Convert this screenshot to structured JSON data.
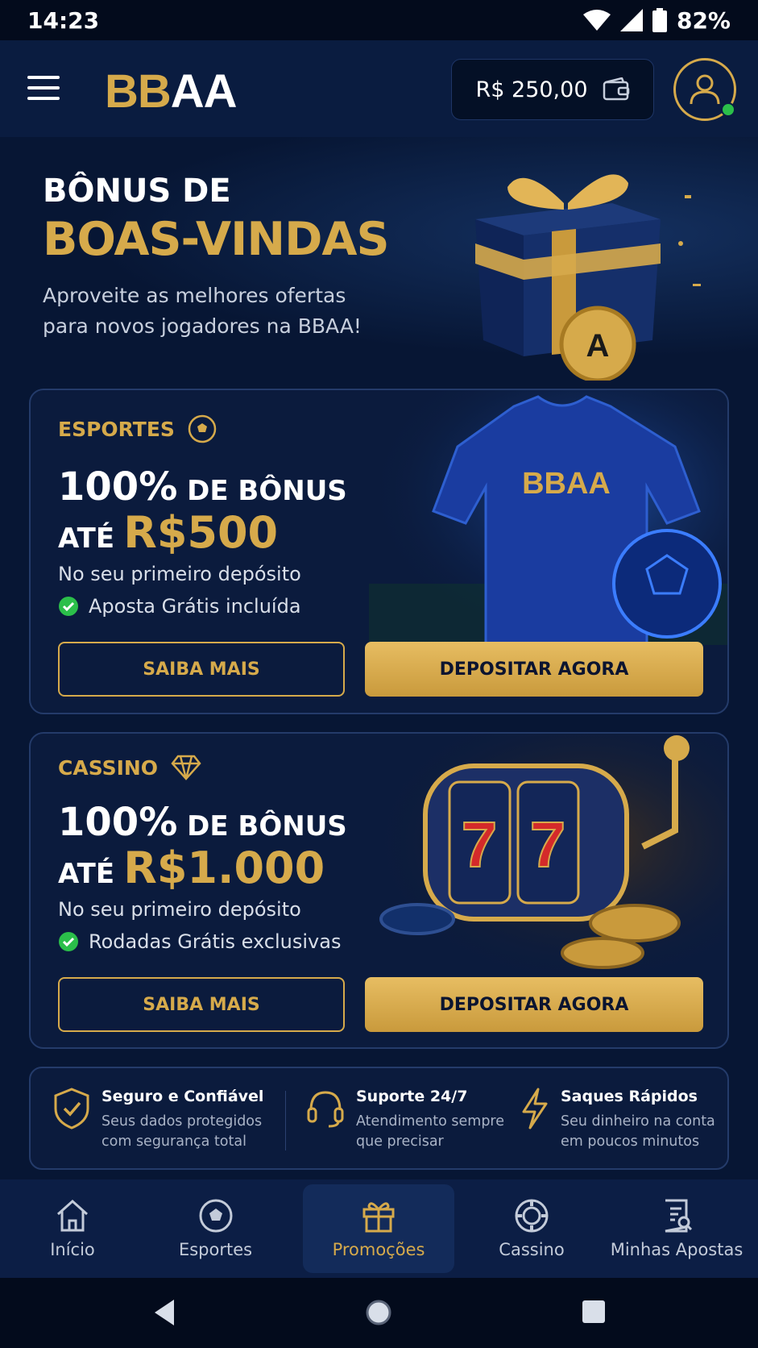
{
  "status_bar": {
    "time": "14:23",
    "battery": "82%"
  },
  "header": {
    "logo_gold": "BB",
    "logo_white": "AA",
    "balance": "R$ 250,00"
  },
  "hero": {
    "line1": "BÔNUS DE",
    "line2": "BOAS-VINDAS",
    "subtitle": "Aproveite as melhores ofertas para novos jogadores na BBAA!"
  },
  "cards": [
    {
      "tag": "ESPORTES",
      "pct": "100%",
      "bonus_word": " DE BÔNUS",
      "ate": "ATÉ",
      "amount": "R$500",
      "desc": "No seu primeiro depósito",
      "check": "Aposta Grátis incluída",
      "btn_more": "SAIBA MAIS",
      "btn_deposit": "DEPOSITAR AGORA",
      "jersey_text": "BBAA"
    },
    {
      "tag": "CASSINO",
      "pct": "100%",
      "bonus_word": " DE BÔNUS",
      "ate": "ATÉ",
      "amount": "R$1.000",
      "desc": "No seu primeiro depósito",
      "check": "Rodadas Grátis exclusivas",
      "btn_more": "SAIBA MAIS",
      "btn_deposit": "DEPOSITAR AGORA",
      "reel_value": "7"
    }
  ],
  "features": [
    {
      "title": "Seguro e Confiável",
      "text": "Seus dados protegidos com segurança total",
      "icon": "shield-check-icon"
    },
    {
      "title": "Suporte 24/7",
      "text": "Atendimento sempre que precisar",
      "icon": "headset-icon"
    },
    {
      "title": "Saques Rápidos",
      "text": "Seu dinheiro na conta em poucos minutos",
      "icon": "lightning-icon"
    }
  ],
  "nav": [
    {
      "label": "Início",
      "icon": "home-icon"
    },
    {
      "label": "Esportes",
      "icon": "soccer-ball-icon"
    },
    {
      "label": "Promoções",
      "icon": "gift-icon",
      "active": true
    },
    {
      "label": "Cassino",
      "icon": "casino-chip-icon"
    },
    {
      "label": "Minhas Apostas",
      "icon": "bet-slip-icon"
    }
  ],
  "colors": {
    "gold": "#d6aa4b",
    "background": "#071634",
    "card": "#0b1b3d",
    "border": "#243b6a",
    "online": "#2bbf4a"
  }
}
